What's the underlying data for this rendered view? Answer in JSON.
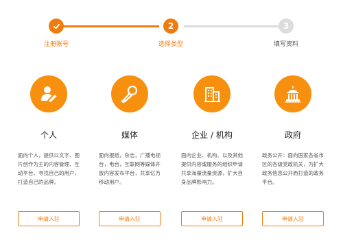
{
  "stepper": {
    "steps": [
      {
        "label": "注册账号",
        "number": "",
        "state": "completed"
      },
      {
        "label": "选择类型",
        "number": "2",
        "state": "active"
      },
      {
        "label": "填写资料",
        "number": "3",
        "state": "inactive"
      }
    ]
  },
  "cards": [
    {
      "icon": "person-pen-icon",
      "title": "个人",
      "description": "面向个人，提供以文字、图片创作为主的内容管理、互动平台、寻找自己的用户，打造自己的品牌。",
      "button_label": "申请入驻"
    },
    {
      "icon": "microphone-icon",
      "title": "媒体",
      "description": "面向报纸，杂志，广播电视台，电台，互联网等媒体开放内容发布平台，共享亿万移动用户。",
      "button_label": "申请入驻"
    },
    {
      "icon": "office-buildings-icon",
      "title": "企业 / 机构",
      "description": "面向企业、机构、以及其他提供内容或服务的组织申请共享海量流量资源，扩大自身品牌影响力。",
      "button_label": "申请入驻"
    },
    {
      "icon": "government-building-icon",
      "title": "政府",
      "description": "政务公开：面向国家各省市区的各级党政机关，为扩大政务信息公开而打造的政务平台。",
      "button_label": "申请入驻"
    }
  ],
  "colors": {
    "accent": "#f07c10",
    "icon_bg": "#f7900f",
    "inactive": "#dcdcdc"
  }
}
